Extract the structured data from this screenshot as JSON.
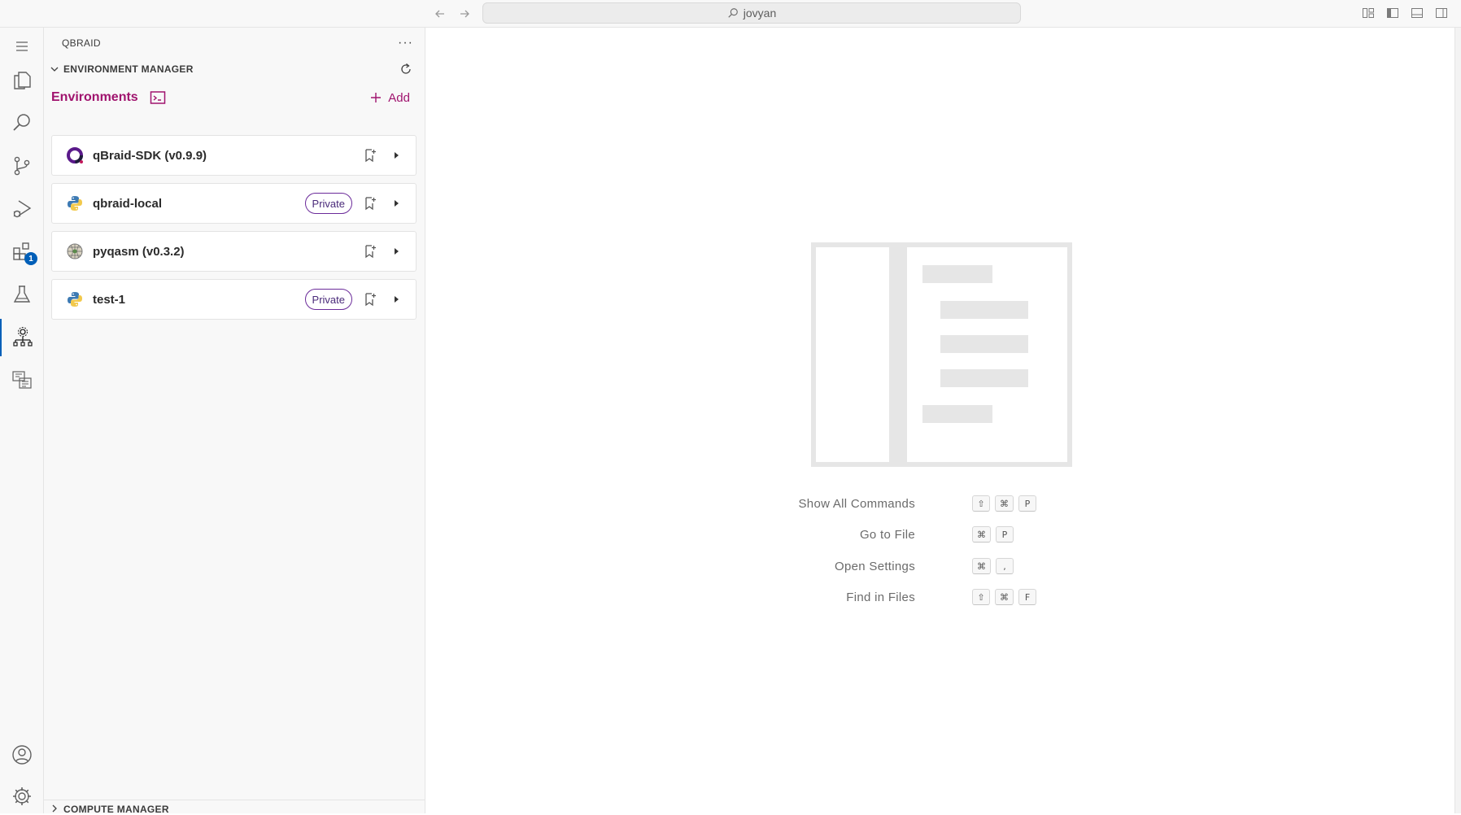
{
  "titlebar": {
    "search_text": "jovyan"
  },
  "activity_bar": {
    "extensions_badge": "1"
  },
  "sidebar": {
    "header": "QBRAID",
    "more_label": "···",
    "environment_manager": {
      "title": "ENVIRONMENT MANAGER",
      "heading": "Environments",
      "add_label": "Add",
      "environments": [
        {
          "name": "qBraid-SDK (v0.9.9)",
          "icon": "qbraid-logo-icon",
          "private": false
        },
        {
          "name": "qbraid-local",
          "icon": "python-icon",
          "private": true,
          "badge": "Private"
        },
        {
          "name": "pyqasm (v0.3.2)",
          "icon": "pyqasm-icon",
          "private": false
        },
        {
          "name": "test-1",
          "icon": "python-icon",
          "private": true,
          "badge": "Private"
        }
      ]
    },
    "compute_manager": {
      "title": "COMPUTE MANAGER"
    }
  },
  "editor": {
    "shortcuts": [
      {
        "label": "Show All Commands",
        "keys": [
          "⇧",
          "⌘",
          "P"
        ]
      },
      {
        "label": "Go to File",
        "keys": [
          "⌘",
          "P"
        ]
      },
      {
        "label": "Open Settings",
        "keys": [
          "⌘",
          ","
        ]
      },
      {
        "label": "Find in Files",
        "keys": [
          "⇧",
          "⌘",
          "F"
        ]
      }
    ]
  },
  "colors": {
    "accent_magenta": "#a0136e",
    "private_pill_border": "#6b2b9a",
    "activity_active": "#005fb8"
  }
}
